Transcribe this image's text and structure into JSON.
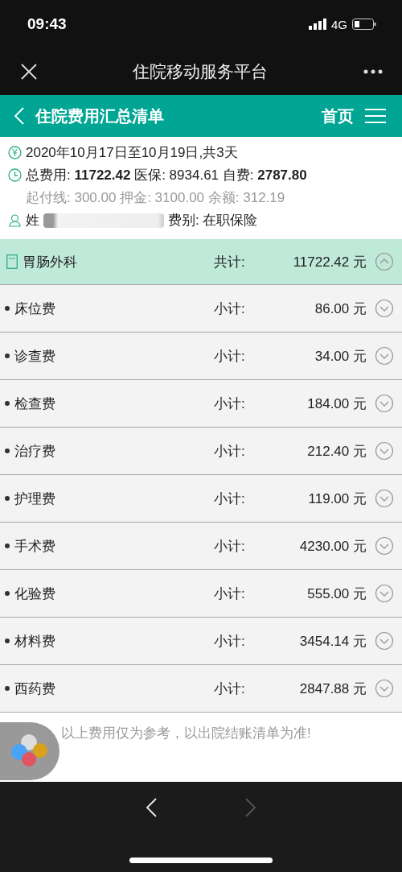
{
  "status_bar": {
    "time": "09:43",
    "network": "4G"
  },
  "nav_bar": {
    "title": "住院移动服务平台"
  },
  "header": {
    "title": "住院费用汇总清单",
    "home": "首页"
  },
  "summary": {
    "dates": "2020年10月17日至10月19日,共3天",
    "totals": "总费用: **11722.42** 医保: 8934.61 自费: **2787.80**",
    "balance": "起付线: 300.00 押金: 3100.00 余额: 312.19",
    "name_label": "姓",
    "category": "费别: 在职保险"
  },
  "department": {
    "name": "胃肠外科",
    "total_label": "共计:",
    "total": "11722.42 元",
    "expanded": true
  },
  "items": [
    {
      "name": "床位费",
      "label": "小计:",
      "amount": "86.00 元",
      "expanded": false
    },
    {
      "name": "诊查费",
      "label": "小计:",
      "amount": "34.00 元",
      "expanded": false
    },
    {
      "name": "检查费",
      "label": "小计:",
      "amount": "184.00 元",
      "expanded": false
    },
    {
      "name": "治疗费",
      "label": "小计:",
      "amount": "212.40 元",
      "expanded": false
    },
    {
      "name": "护理费",
      "label": "小计:",
      "amount": "119.00 元",
      "expanded": false
    },
    {
      "name": "手术费",
      "label": "小计:",
      "amount": "4230.00 元",
      "expanded": false
    },
    {
      "name": "化验费",
      "label": "小计:",
      "amount": "555.00 元",
      "expanded": false
    },
    {
      "name": "材料费",
      "label": "小计:",
      "amount": "3454.14 元",
      "expanded": false
    },
    {
      "name": "西药费",
      "label": "小计:",
      "amount": "2847.88 元",
      "expanded": false
    }
  ],
  "footer_note": "以上费用仅为参考，以出院结账清单为准!"
}
